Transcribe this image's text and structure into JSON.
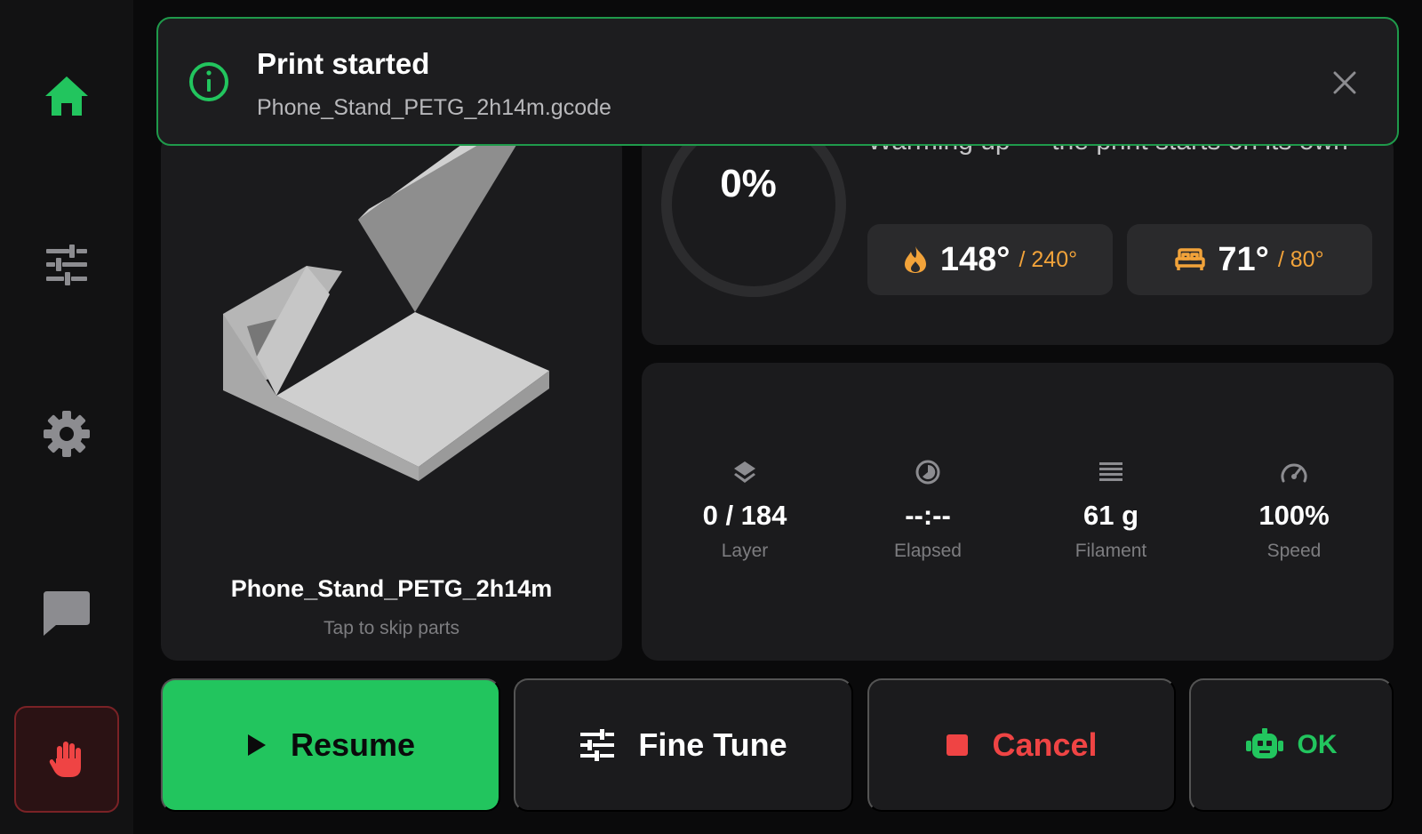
{
  "sidebar": {
    "items": [
      {
        "name": "home",
        "icon": "home-icon",
        "active": true
      },
      {
        "name": "tune",
        "icon": "sliders-icon",
        "active": false
      },
      {
        "name": "settings",
        "icon": "gear-icon",
        "active": false
      },
      {
        "name": "messages",
        "icon": "chat-icon",
        "active": false
      }
    ],
    "emergency_stop_icon": "hand-stop-icon"
  },
  "toast": {
    "icon": "info-icon",
    "title": "Print started",
    "body": "Phone_Stand_PETG_2h14m.gcode",
    "close_icon": "close-icon"
  },
  "preview": {
    "file_name": "Phone_Stand_PETG_2h14m",
    "hint": "Tap to skip parts"
  },
  "status": {
    "progress_percent_text": "0%",
    "progress_value": 0,
    "message": "Warming up — the print starts on its own",
    "hotend": {
      "icon": "flame-icon",
      "current": "148°",
      "target": "/ 240°"
    },
    "bed": {
      "icon": "bed-icon",
      "current": "71°",
      "target": "/ 80°"
    }
  },
  "stats": [
    {
      "icon": "layers-icon",
      "value": "0 / 184",
      "label": "Layer"
    },
    {
      "icon": "clock-icon",
      "value": "--:--",
      "label": "Elapsed"
    },
    {
      "icon": "filament-icon",
      "value": "61 g",
      "label": "Filament"
    },
    {
      "icon": "speedometer-icon",
      "value": "100%",
      "label": "Speed"
    }
  ],
  "actions": {
    "resume": "Resume",
    "fine_tune": "Fine Tune",
    "cancel": "Cancel",
    "ok": "OK"
  },
  "colors": {
    "accent_green": "#22c55e",
    "danger_red": "#ef4444",
    "warm_orange": "#f2a33a",
    "panel": "#1b1b1d",
    "background": "#0a0a0b"
  }
}
